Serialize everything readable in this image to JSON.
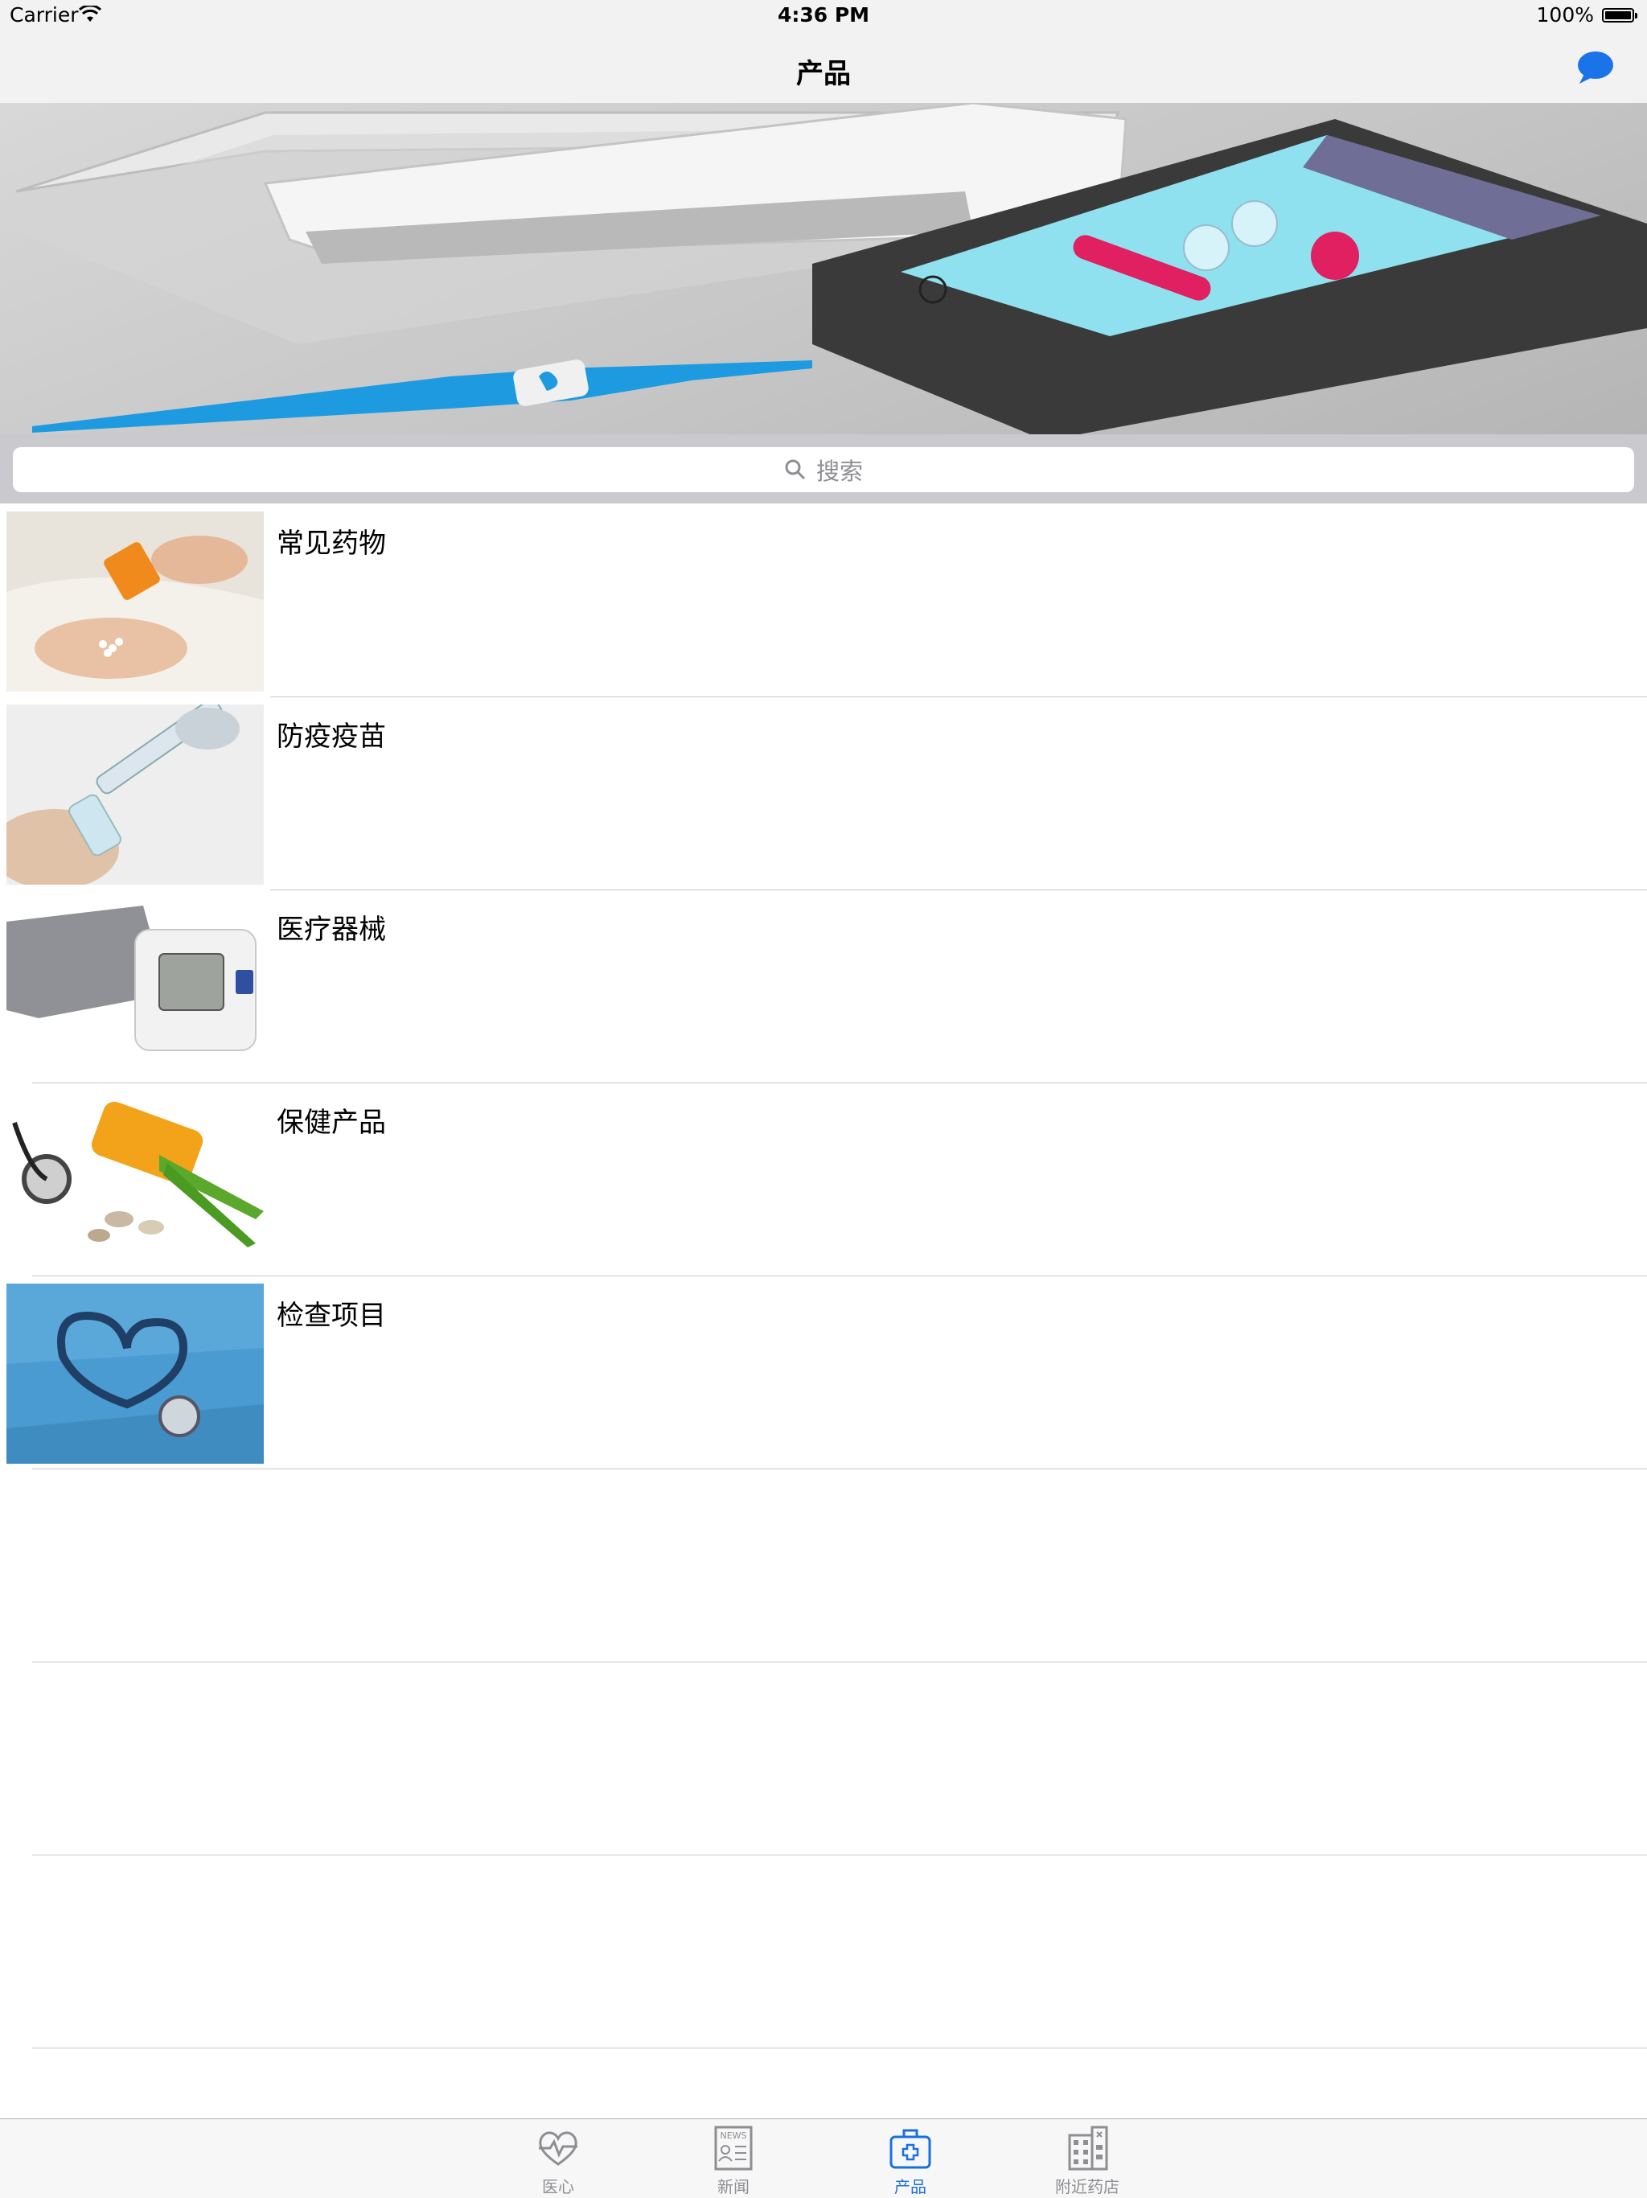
{
  "status_bar": {
    "carrier": "Carrier",
    "time": "4:36 PM",
    "battery": "100%"
  },
  "nav": {
    "title": "产品",
    "right_icon": "chat-bubble-icon",
    "accent": "#1a73e8"
  },
  "banner": {
    "image": "smart-thermometer-with-phone"
  },
  "search": {
    "placeholder": "搜索"
  },
  "products": [
    {
      "label": "常见药物",
      "image": "hand-pouring-pills"
    },
    {
      "label": "防疫疫苗",
      "image": "syringe-vial"
    },
    {
      "label": "医疗器械",
      "image": "blood-pressure-monitor"
    },
    {
      "label": "保健产品",
      "image": "stethoscope-supplements"
    },
    {
      "label": "检查项目",
      "image": "stethoscope-heart"
    }
  ],
  "tabs": [
    {
      "label": "医心",
      "icon": "heart-pulse-icon",
      "active": false
    },
    {
      "label": "新闻",
      "icon": "news-icon",
      "active": false
    },
    {
      "label": "产品",
      "icon": "medical-kit-icon",
      "active": true
    },
    {
      "label": "附近药店",
      "icon": "building-icon",
      "active": false
    }
  ]
}
